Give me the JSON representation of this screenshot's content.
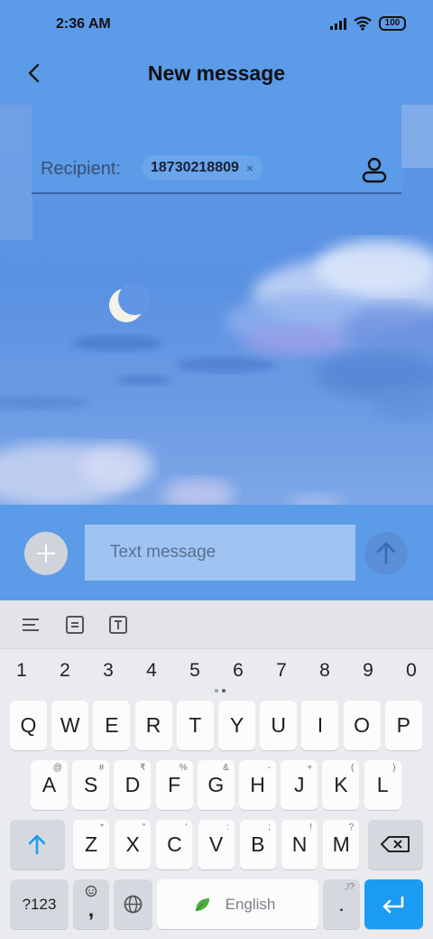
{
  "status_bar": {
    "time": "2:36 AM",
    "battery": "100"
  },
  "header": {
    "title": "New message"
  },
  "recipient": {
    "label": "Recipient:",
    "number": "18730218809",
    "remove_glyph": "×"
  },
  "compose": {
    "placeholder": "Text message"
  },
  "keyboard": {
    "numbers": [
      "1",
      "2",
      "3",
      "4",
      "5",
      "6",
      "7",
      "8",
      "9",
      "0"
    ],
    "row1": [
      {
        "label": "Q"
      },
      {
        "label": "W"
      },
      {
        "label": "E"
      },
      {
        "label": "R"
      },
      {
        "label": "T"
      },
      {
        "label": "Y"
      },
      {
        "label": "U"
      },
      {
        "label": "I"
      },
      {
        "label": "O"
      },
      {
        "label": "P"
      }
    ],
    "row2": [
      {
        "label": "A",
        "hint": "@"
      },
      {
        "label": "S",
        "hint": "#"
      },
      {
        "label": "D",
        "hint": "₹"
      },
      {
        "label": "F",
        "hint": "%"
      },
      {
        "label": "G",
        "hint": "&"
      },
      {
        "label": "H",
        "hint": "-"
      },
      {
        "label": "J",
        "hint": "+"
      },
      {
        "label": "K",
        "hint": "("
      },
      {
        "label": "L",
        "hint": ")"
      }
    ],
    "row3": [
      {
        "label": "Z",
        "hint": "*"
      },
      {
        "label": "X",
        "hint": "\""
      },
      {
        "label": "C",
        "hint": "'"
      },
      {
        "label": "V",
        "hint": ":"
      },
      {
        "label": "B",
        "hint": ";"
      },
      {
        "label": "N",
        "hint": "!"
      },
      {
        "label": "M",
        "hint": "?"
      }
    ],
    "symbols_key": "?123",
    "comma_key": ",",
    "space_label": "English",
    "period_key": ".",
    "period_hint": ",!?"
  },
  "icons": {
    "back": "back-arrow-icon",
    "contact": "contact-icon",
    "attach": "plus-icon",
    "send": "send-arrow-icon",
    "shift": "shift-arrow-icon",
    "backspace": "backspace-icon",
    "globe": "globe-icon",
    "enter": "enter-icon",
    "emoji": "emoji-icon",
    "leaf": "leaf-icon"
  },
  "colors": {
    "app_blue": "#5b9be8",
    "enter_key": "#1a9cf3",
    "keyboard_bg": "#e9ebee"
  }
}
